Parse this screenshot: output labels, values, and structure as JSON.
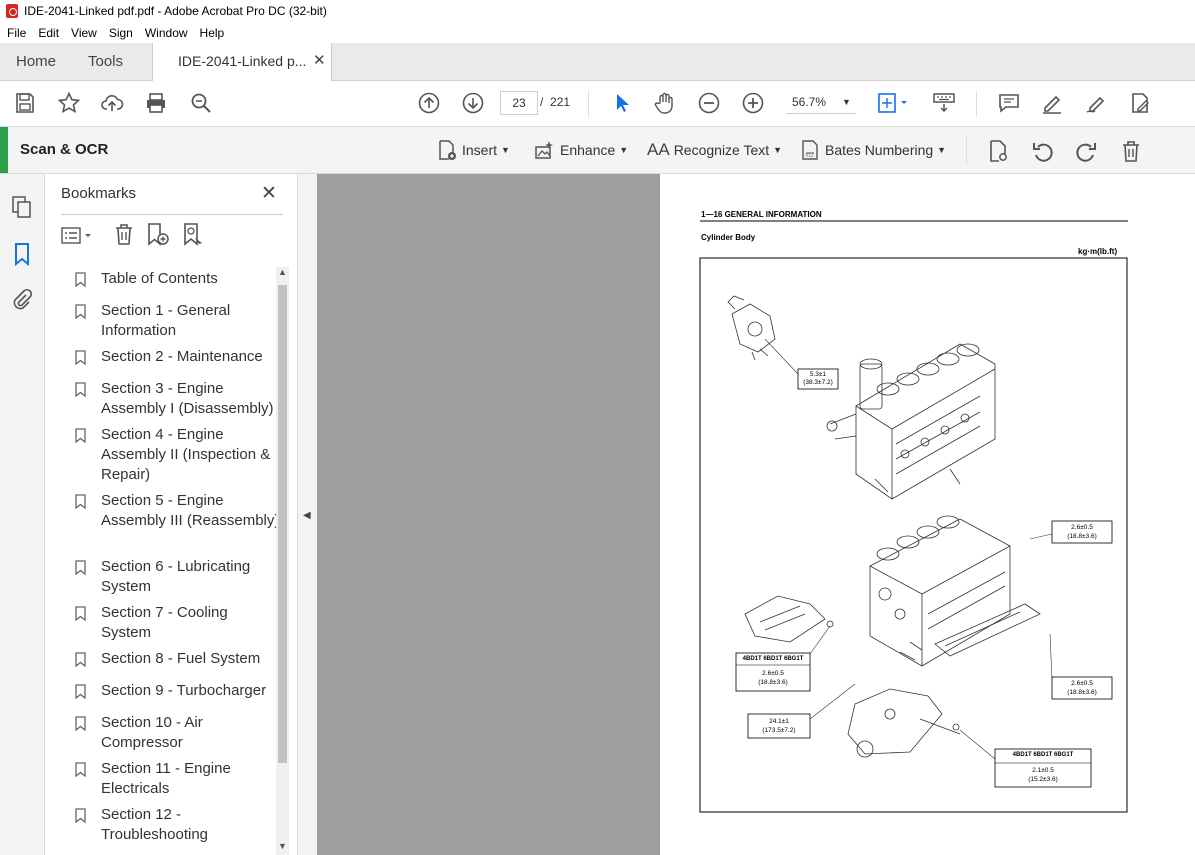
{
  "window": {
    "title": "IDE-2041-Linked pdf.pdf - Adobe Acrobat Pro DC (32-bit)"
  },
  "menu": [
    "File",
    "Edit",
    "View",
    "Sign",
    "Window",
    "Help"
  ],
  "tabs": {
    "home": "Home",
    "tools": "Tools",
    "document": "IDE-2041-Linked p...",
    "close": "✕"
  },
  "toolbar": {
    "current_page": "23",
    "page_sep": "/",
    "total_pages": "221",
    "zoom": "56.7%"
  },
  "ocr": {
    "title": "Scan & OCR",
    "insert": "Insert",
    "enhance": "Enhance",
    "recognize": "Recognize Text",
    "bates": "Bates Numbering"
  },
  "bookmarks": {
    "title": "Bookmarks",
    "close": "✕",
    "items": [
      "Table of Contents",
      "Section 1 - General Information",
      "Section 2 - Maintenance",
      "Section 3 - Engine Assembly I (Disassembly)",
      "Section 4 - Engine Assembly II (Inspection & Repair)",
      "Section 5 - Engine Assembly III (Reassembly)",
      "Section 6 - Lubricating System",
      "Section 7 - Cooling System",
      "Section 8 - Fuel System",
      "Section 9 - Turbocharger",
      "Section 10 - Air Compressor",
      "Section 11 - Engine Electricals",
      "Section 12 - Troubleshooting"
    ]
  },
  "page": {
    "header": "1—16  GENERAL INFORMATION",
    "subtitle": "Cylinder Body",
    "units": "kg·m(lb.ft)",
    "torque1": [
      "5.3±1",
      "(38.3±7.2)"
    ],
    "torque2": [
      "2.6±0.5",
      "(18.8±3.6)"
    ],
    "torque3_head": "4BD1T  6BD1T  6BG1T",
    "torque3": [
      "2.6±0.5",
      "(18.8±3.6)"
    ],
    "torque4": [
      "2.6±0.5",
      "(18.8±3.6)"
    ],
    "torque5": [
      "24.1±1",
      "(173.5±7.2)"
    ],
    "torque6_head": "4BD1T  6BD1T  6BG1T",
    "torque6": [
      "2.1±0.5",
      "(15.2±3.6)"
    ]
  },
  "colors": {
    "accent": "#2d9f4a",
    "cursor_blue": "#1473e6",
    "doc_bg": "#9e9e9e"
  }
}
